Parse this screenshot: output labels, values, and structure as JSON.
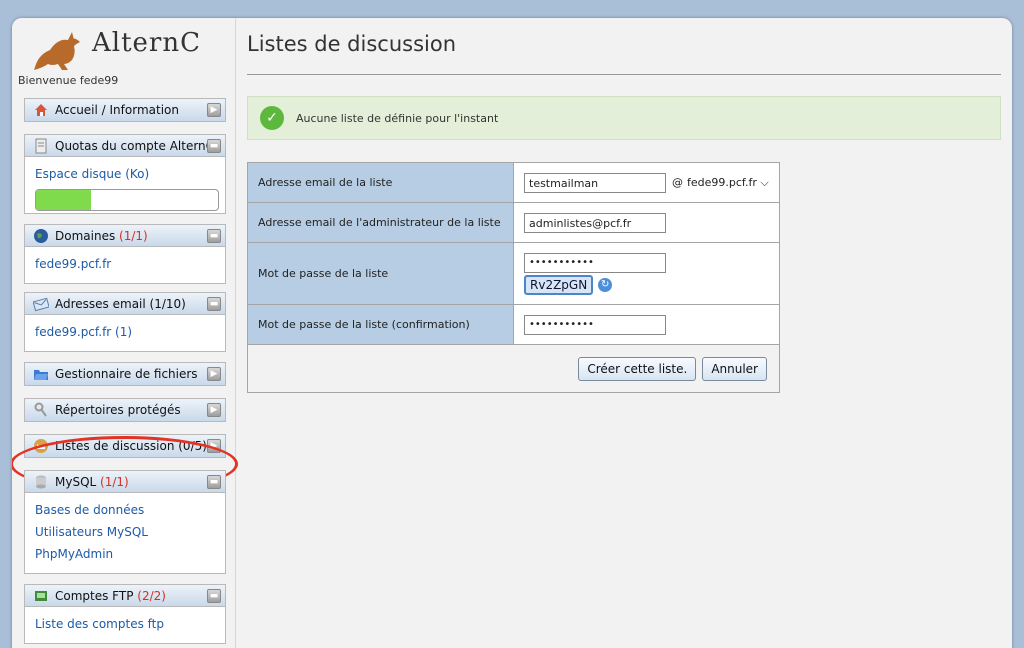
{
  "sidebar": {
    "logo_text": "AlternC",
    "welcome": "Bienvenue fede99",
    "menus": {
      "accueil": {
        "label": "Accueil / Information"
      },
      "quotas": {
        "label": "Quotas du compte AlternC",
        "link": "Espace disque (Ko)",
        "progress": 0.3
      },
      "domaines": {
        "label": "Domaines",
        "count": "(1/1)",
        "link": "fede99.pcf.fr"
      },
      "adresses": {
        "label": "Adresses email (1/10)",
        "link": "fede99.pcf.fr (1)"
      },
      "fichiers": {
        "label": "Gestionnaire de fichiers"
      },
      "repertoires": {
        "label": "Répertoires protégés"
      },
      "listes": {
        "label": "Listes de discussion (0/5)"
      },
      "mysql": {
        "label": "MySQL",
        "count": "(1/1)",
        "links": [
          "Bases de données",
          "Utilisateurs MySQL",
          "PhpMyAdmin"
        ]
      },
      "ftp": {
        "label": "Comptes FTP",
        "count": "(2/2)",
        "link": "Liste des comptes ftp"
      }
    }
  },
  "main": {
    "title": "Listes de discussion",
    "notice": "Aucune liste de définie pour l'instant",
    "form": {
      "email_label": "Adresse email de la liste",
      "email_value": "testmailman",
      "at": "@",
      "domain_value": "fede99.pcf.fr",
      "admin_label": "Adresse email de l'administrateur de la liste",
      "admin_value": "adminlistes@pcf.fr",
      "password_label": "Mot de passe de la liste",
      "password_value": "•••••••••••",
      "captcha": "Rv2ZpGN",
      "confirm_label": "Mot de passe de la liste (confirmation)",
      "confirm_value": "•••••••••••",
      "create_button": "Créer cette liste.",
      "cancel_button": "Annuler"
    }
  },
  "colors": {
    "highlight": "#e23424",
    "header": "#c9d9ea",
    "label_bg": "#b6cde3"
  }
}
